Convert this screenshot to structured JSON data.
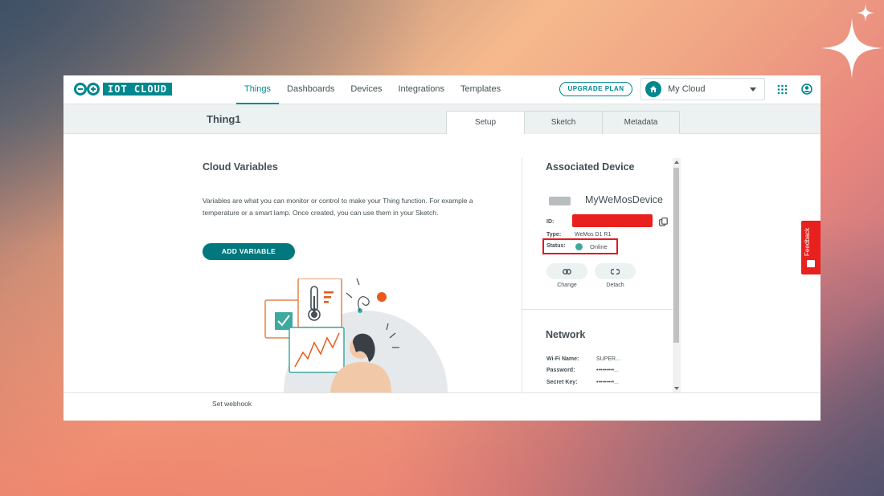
{
  "header": {
    "logo_text": "IOT CLOUD",
    "nav": [
      "Things",
      "Dashboards",
      "Devices",
      "Integrations",
      "Templates"
    ],
    "upgrade_label": "UPGRADE PLAN",
    "space_label": "My Cloud"
  },
  "thing": {
    "title": "Thing1",
    "tabs": [
      "Setup",
      "Sketch",
      "Metadata"
    ]
  },
  "cloud_variables": {
    "title": "Cloud Variables",
    "description": "Variables are what you can monitor or control to make your Thing function. For example a temperature or a smart lamp. Once created, you can use them in your Sketch.",
    "add_label": "ADD VARIABLE"
  },
  "device": {
    "section_title": "Associated Device",
    "name": "MyWeMosDevice",
    "id_label": "ID:",
    "type_label": "Type:",
    "type_value": "WeMos D1 R1",
    "status_label": "Status:",
    "status_value": "Online",
    "change_label": "Change",
    "detach_label": "Detach"
  },
  "network": {
    "title": "Network",
    "rows": [
      {
        "label": "Wi-Fi Name:",
        "value": "SUPER..."
      },
      {
        "label": "Password:",
        "value": "•••••••••..."
      },
      {
        "label": "Secret Key:",
        "value": "•••••••••..."
      }
    ]
  },
  "footer": {
    "webhook_label": "Set webhook"
  },
  "feedback_label": "Feedback",
  "colors": {
    "accent": "#00878f",
    "status_online": "#3ea99f",
    "highlight_red": "#e11a22"
  }
}
